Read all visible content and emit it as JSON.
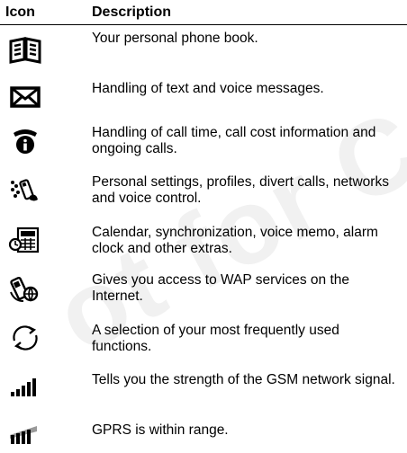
{
  "watermark": "ot for Com",
  "header": {
    "icon_col": "Icon",
    "desc_col": "Description"
  },
  "rows": [
    {
      "icon": "phonebook-icon",
      "description": "Your personal phone book."
    },
    {
      "icon": "envelope-icon",
      "description": "Handling of text and voice messages."
    },
    {
      "icon": "phone-info-icon",
      "description": "Handling of call time, call cost information and ongoing calls."
    },
    {
      "icon": "phone-settings-icon",
      "description": "Personal settings, profiles, divert calls, networks and voice control."
    },
    {
      "icon": "calendar-extras-icon",
      "description": "Calendar, synchronization, voice memo, alarm clock and other extras."
    },
    {
      "icon": "wap-icon",
      "description": "Gives you access to WAP services on the Internet."
    },
    {
      "icon": "shortcuts-icon",
      "description": "A selection of your most frequently used functions."
    },
    {
      "icon": "signal-strength-icon",
      "description": "Tells you the strength of the GSM network signal."
    },
    {
      "icon": "gprs-icon",
      "description": "GPRS is within range."
    }
  ]
}
